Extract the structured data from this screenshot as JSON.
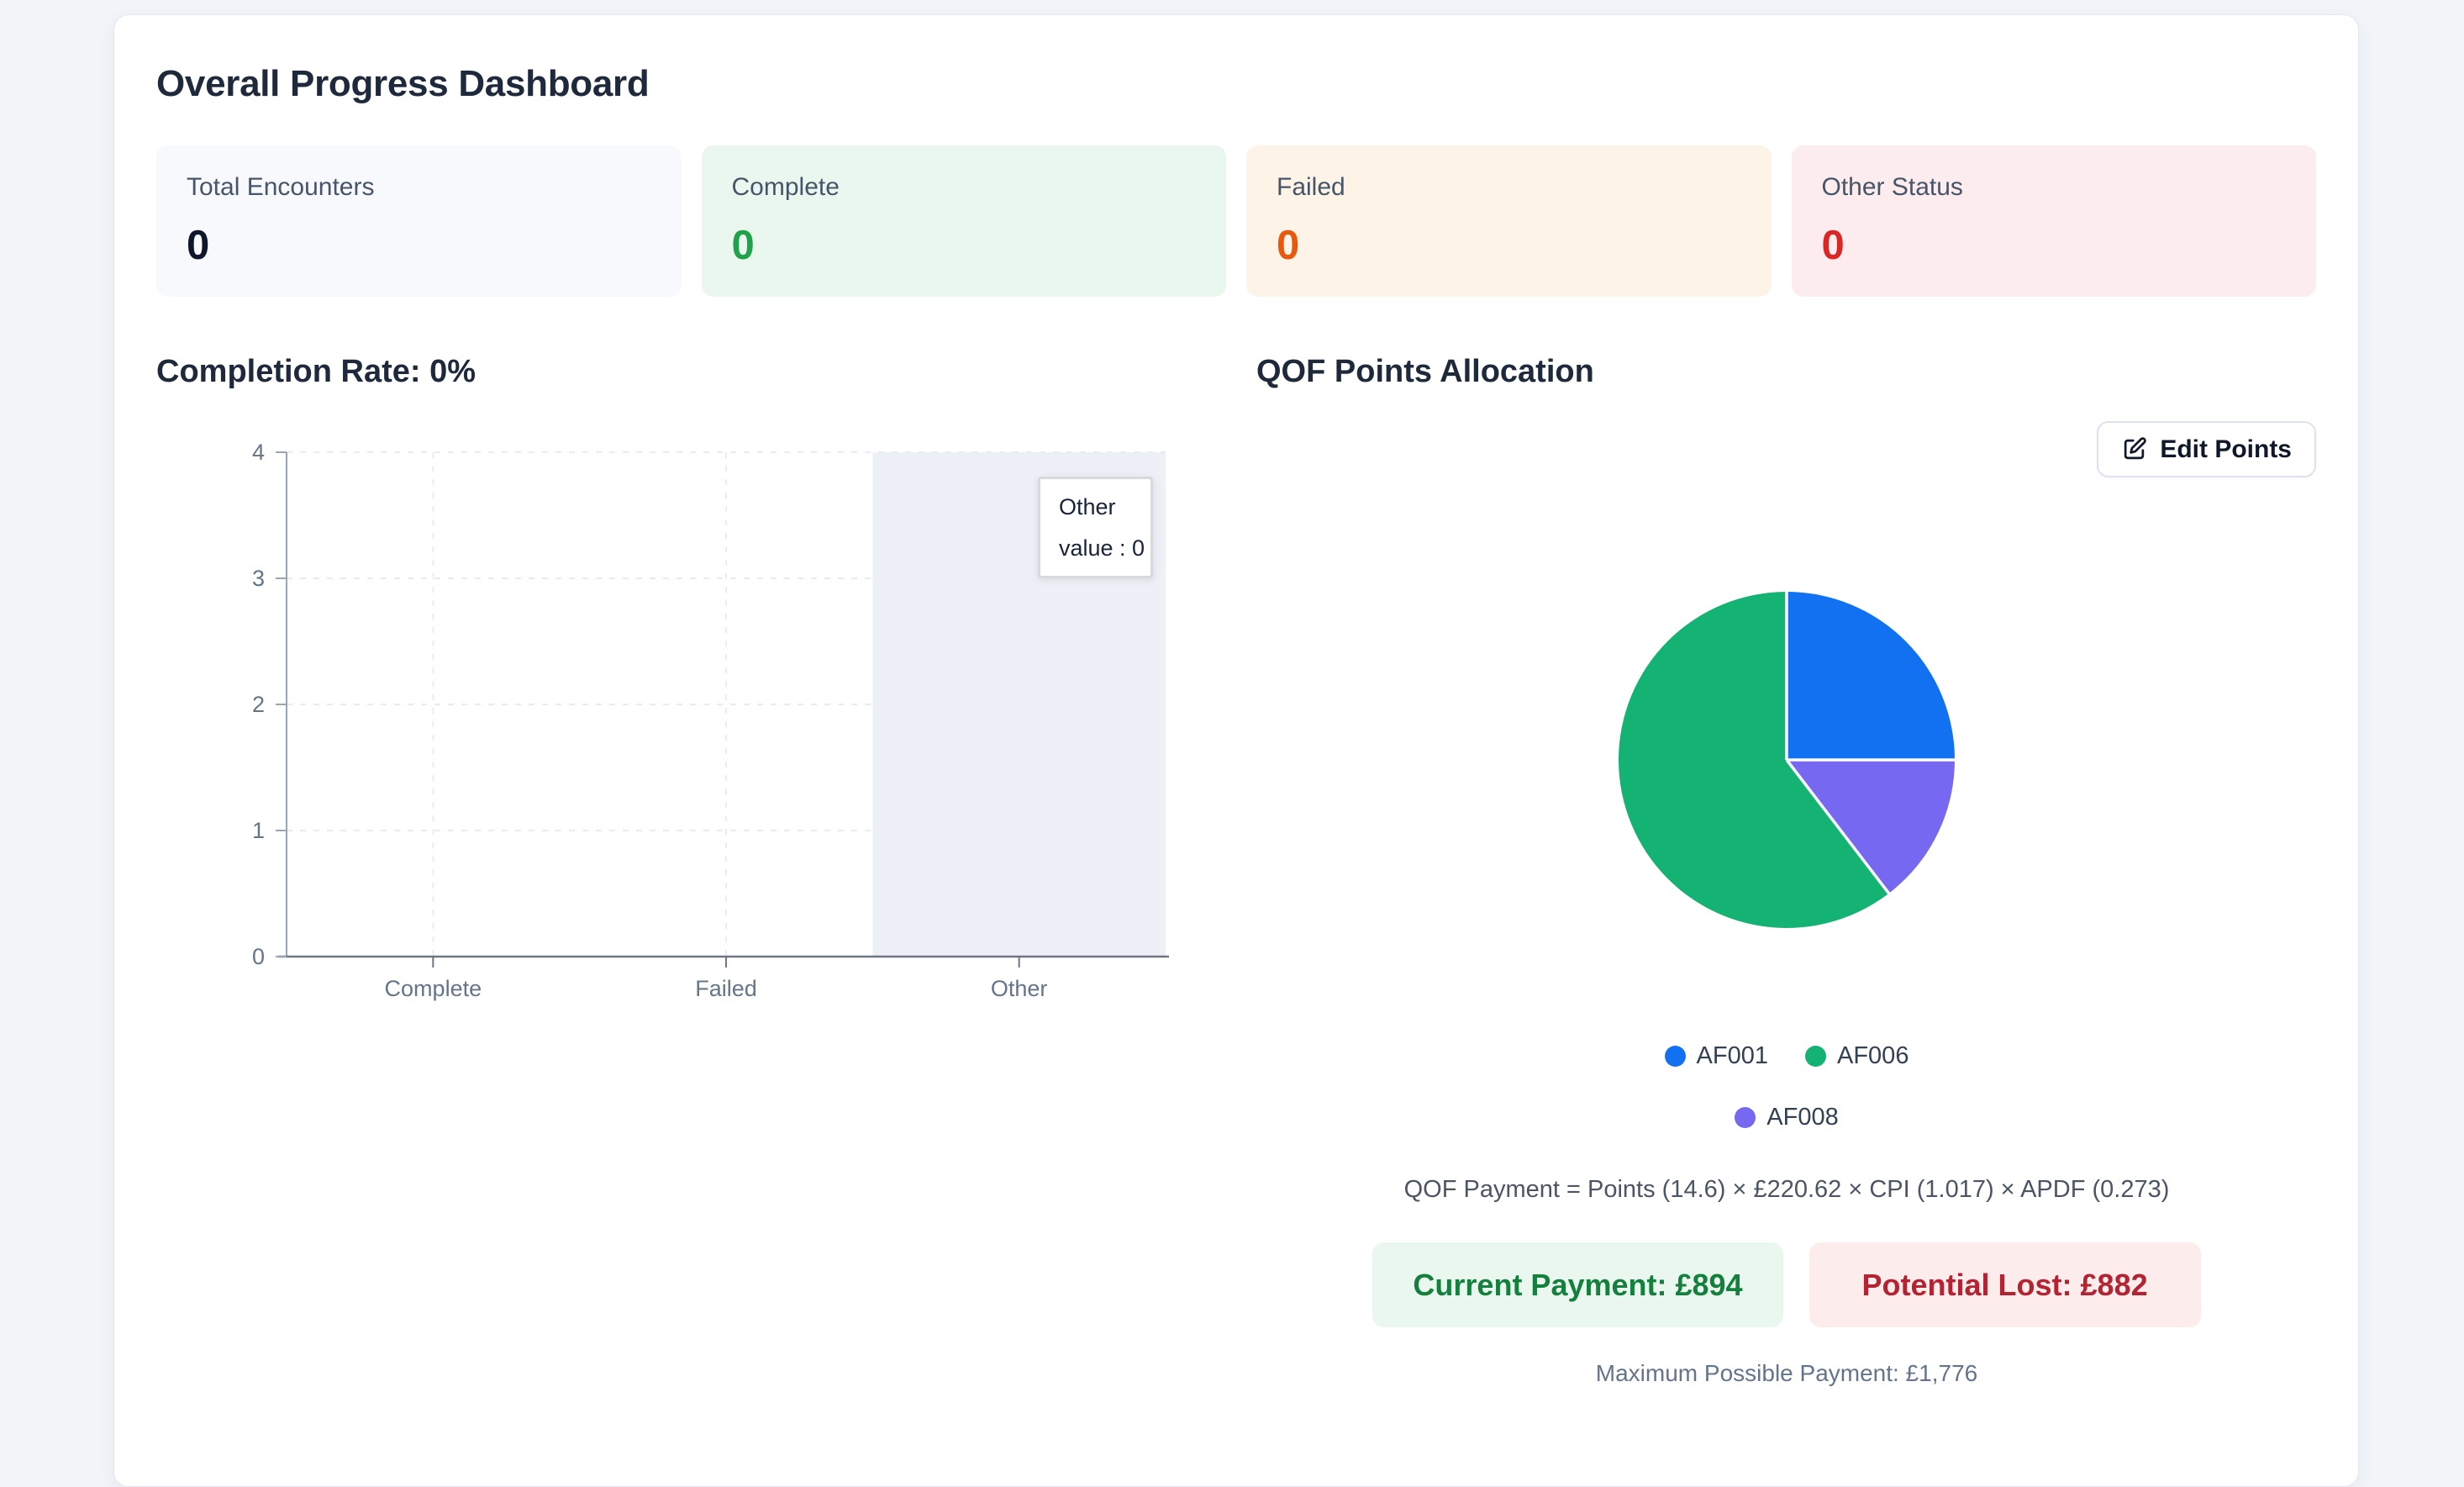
{
  "page": {
    "background": "#f1f4f9"
  },
  "dashboard": {
    "title": "Overall Progress Dashboard"
  },
  "stats": {
    "cards": [
      {
        "label": "Total Encounters",
        "value": "0",
        "accent": "#0f172a",
        "bg": "#f7f9fc"
      },
      {
        "label": "Complete",
        "value": "0",
        "accent": "#1ea34a",
        "bg": "#e9f7ef"
      },
      {
        "label": "Failed",
        "value": "0",
        "accent": "#ea580c",
        "bg": "#fdf3e7"
      },
      {
        "label": "Other Status",
        "value": "0",
        "accent": "#dc2626",
        "bg": "#fcecee"
      }
    ]
  },
  "completion": {
    "title": "Completion Rate: 0%"
  },
  "qof": {
    "title": "QOF Points Allocation",
    "edit_button_label": "Edit Points",
    "formula": "QOF Payment = Points (14.6) × £220.62 × CPI (1.017) × APDF (0.273)",
    "current_payment_label": "Current Payment: £894",
    "potential_lost_label": "Potential Lost: £882",
    "max_payment_label": "Maximum Possible Payment: £1,776",
    "current_color": "#15803d",
    "lost_color": "#b42331"
  },
  "chart_data": [
    {
      "type": "bar",
      "title": "Completion Rate: 0%",
      "categories": [
        "Complete",
        "Failed",
        "Other"
      ],
      "values": [
        0,
        0,
        0
      ],
      "xlabel": "",
      "ylabel": "",
      "ylim": [
        0,
        4
      ],
      "yticks": [
        0,
        1,
        2,
        3,
        4
      ],
      "grid": true,
      "highlighted_category": "Other",
      "highlight_color": "#edf1f7",
      "tooltip": {
        "title": "Other",
        "line": "value : 0"
      }
    },
    {
      "type": "pie",
      "title": "QOF Points Allocation",
      "slices": [
        {
          "label": "AF001",
          "percent": 25.0,
          "color": "#1171f0"
        },
        {
          "label": "AF008",
          "percent": 14.6,
          "color": "#7668f0"
        },
        {
          "label": "AF006",
          "percent": 60.4,
          "color": "#14b374"
        }
      ],
      "legend_order": [
        0,
        2,
        1
      ],
      "legend_position": "bottom"
    }
  ]
}
